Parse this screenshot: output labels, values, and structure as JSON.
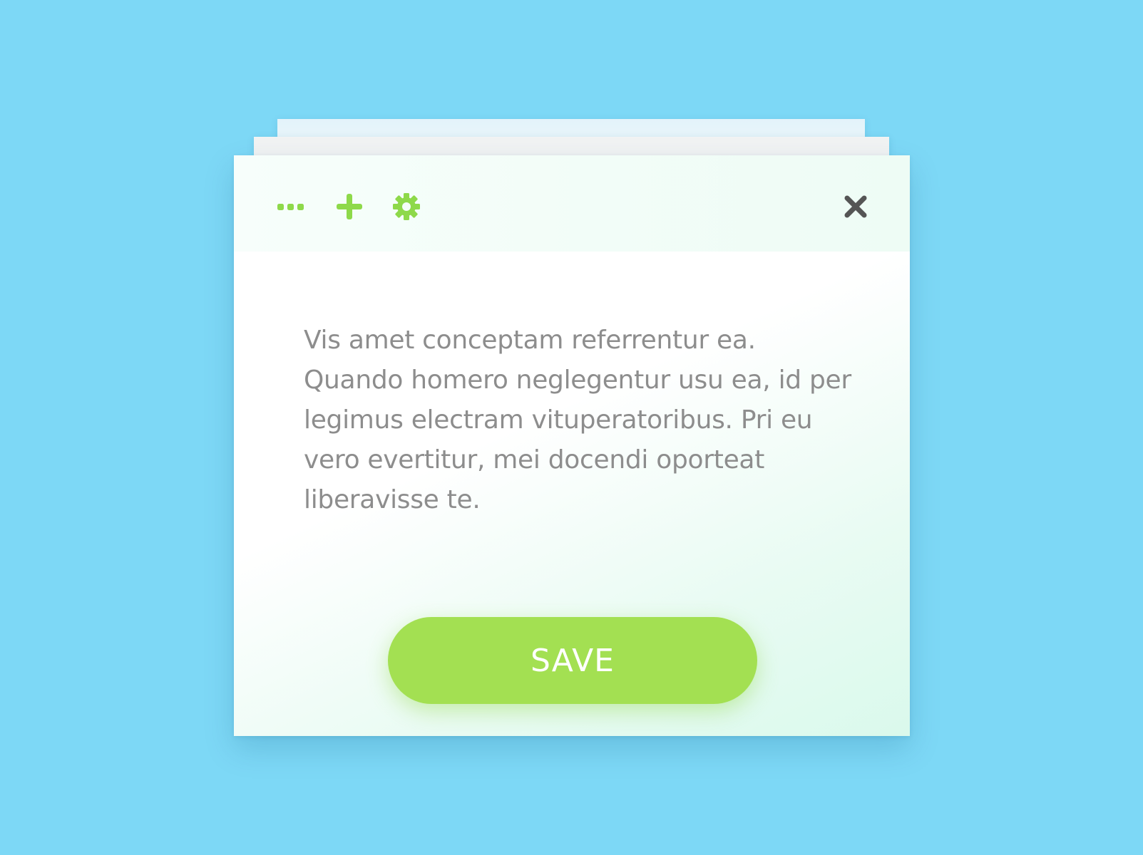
{
  "dialog": {
    "toolbar": {
      "more_icon": "more-dots-icon",
      "add_icon": "plus-icon",
      "settings_icon": "gear-icon",
      "close_icon": "close-icon"
    },
    "body_text": "Vis amet conceptam referrentur ea. Quando homero neglegentur usu ea, id per legimus electram vituperatoribus. Pri eu vero evertitur, mei docendi oporteat liberavisse te.",
    "save_label": "SAVE"
  },
  "colors": {
    "background": "#7dd8f6",
    "accent_green": "#a3e052",
    "icon_green": "#8ed94a",
    "close_gray": "#555555",
    "text_gray": "#8d8d8d"
  }
}
